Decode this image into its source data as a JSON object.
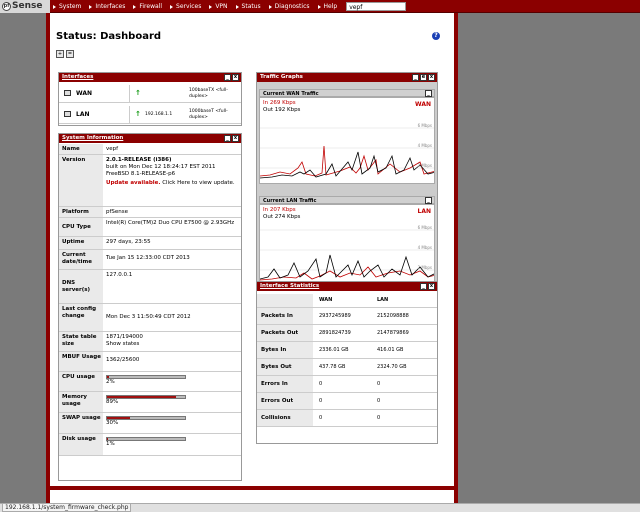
{
  "nav": {
    "logo": "Sense",
    "items": [
      "System",
      "Interfaces",
      "Firewall",
      "Services",
      "VPN",
      "Status",
      "Diagnostics",
      "Help"
    ],
    "hostname": "vepf"
  },
  "page": {
    "title": "Status: Dashboard"
  },
  "interfaces": {
    "title": "Interfaces",
    "rows": [
      {
        "name": "WAN",
        "ip": "",
        "media": "100baseTX <full-duplex>"
      },
      {
        "name": "LAN",
        "ip": "192.168.1.1",
        "media": "1000baseT <full-duplex>"
      }
    ]
  },
  "system_info": {
    "title": "System Information",
    "name_label": "Name",
    "name_value": "vepf",
    "version_label": "Version",
    "version_line1": "2.0.1-RELEASE (i386)",
    "version_line2": "built on Mon Dec 12 18:24:17 EST 2011",
    "version_line3": "FreeBSD 8.1-RELEASE-p6",
    "update_bold": "Update available.",
    "update_rest": " Click Here to view update.",
    "platform_label": "Platform",
    "platform_value": "pfSense",
    "cpu_type_label": "CPU Type",
    "cpu_type_value": "Intel(R) Core(TM)2 Duo CPU E7500 @ 2.93GHz",
    "uptime_label": "Uptime",
    "uptime_value": "297 days, 23:55",
    "current_date_label": "Current date/time",
    "current_date_value": "Tue Jan 15 12:33:00 CDT 2013",
    "dns_label": "DNS server(s)",
    "dns_value": "127.0.0.1",
    "last_config_label": "Last config change",
    "last_config_value": "Mon Dec 3 11:50:49 CDT 2012",
    "state_label": "State table size",
    "state_value": "1871/194000",
    "state_link": "Show states",
    "mbuf_label": "MBUF Usage",
    "mbuf_value": "1362/25600",
    "cpu_usage_label": "CPU usage",
    "cpu_usage_value": "2%",
    "cpu_usage_pct": 0.02,
    "memory_label": "Memory usage",
    "memory_value": "89%",
    "memory_pct": 0.89,
    "swap_label": "SWAP usage",
    "swap_value": "30%",
    "swap_pct": 0.3,
    "disk_label": "Disk usage",
    "disk_value": "1%",
    "disk_pct": 0.01
  },
  "traffic": {
    "title": "Traffic Graphs",
    "wan": {
      "title": "Current WAN Traffic",
      "in": "In    269 Kbps",
      "out": "Out 192 Kbps",
      "label": "WAN",
      "tick1": "6 Mbps",
      "tick2": "4 Mbps",
      "tick3": "2 Mbps"
    },
    "lan": {
      "title": "Current LAN Traffic",
      "in": "In    207 Kbps",
      "out": "Out 274 Kbps",
      "label": "LAN",
      "tick1": "6 Mbps",
      "tick2": "4 Mbps",
      "tick3": "2 Mbps"
    }
  },
  "stats": {
    "title": "Interface Statistics",
    "col_wan": "WAN",
    "col_lan": "LAN",
    "rows": [
      {
        "label": "Packets In",
        "wan": "2937245989",
        "lan": "2152098888"
      },
      {
        "label": "Packets Out",
        "wan": "2891824739",
        "lan": "2147879869"
      },
      {
        "label": "Bytes In",
        "wan": "2336.01 GB",
        "lan": "416.01 GB"
      },
      {
        "label": "Bytes Out",
        "wan": "437.78 GB",
        "lan": "2324.70 GB"
      },
      {
        "label": "Errors In",
        "wan": "0",
        "lan": "0"
      },
      {
        "label": "Errors Out",
        "wan": "0",
        "lan": "0"
      },
      {
        "label": "Collisions",
        "wan": "0",
        "lan": "0"
      }
    ]
  },
  "status_bar": {
    "url": "192.168.1.1/system_firmware_check.php"
  }
}
